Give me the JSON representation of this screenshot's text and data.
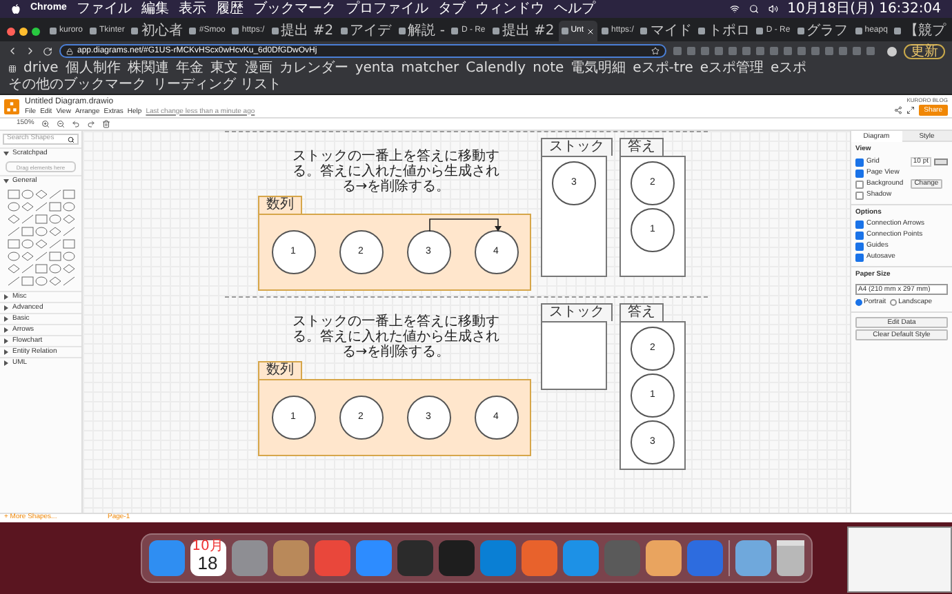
{
  "menubar": {
    "app": "Chrome",
    "items": [
      "ファイル",
      "編集",
      "表示",
      "履歴",
      "ブックマーク",
      "プロファイル",
      "タブ",
      "ウィンドウ",
      "ヘルプ"
    ],
    "clock": "10月18日(月) 16:32:04"
  },
  "tabs": [
    {
      "title": "kuroro",
      "selected": false
    },
    {
      "title": "Tkinter",
      "selected": false
    },
    {
      "title": "初心者",
      "selected": false
    },
    {
      "title": "#Smoo",
      "selected": false
    },
    {
      "title": "https:/",
      "selected": false
    },
    {
      "title": "提出 #2",
      "selected": false
    },
    {
      "title": "アイデ",
      "selected": false
    },
    {
      "title": "解説 -",
      "selected": false
    },
    {
      "title": "D - Re",
      "selected": false
    },
    {
      "title": "提出 #2",
      "selected": false
    },
    {
      "title": "Unt",
      "selected": true
    },
    {
      "title": "https:/",
      "selected": false
    },
    {
      "title": "マイド",
      "selected": false
    },
    {
      "title": "トポロ",
      "selected": false
    },
    {
      "title": "D - Re",
      "selected": false
    },
    {
      "title": "グラフ",
      "selected": false
    },
    {
      "title": "heapq",
      "selected": false
    },
    {
      "title": "【競プ",
      "selected": false
    }
  ],
  "address": {
    "url": "app.diagrams.net/#G1US-rMCKvHScx0wHcvKu_6d0DfGDwOvHj",
    "update_button": "更新"
  },
  "bookmarks": [
    "drive",
    "個人制作",
    "株関連",
    "年金",
    "東文",
    "漫画",
    "カレンダー",
    "yenta",
    "matcher",
    "Calendly",
    "note",
    "電気明細",
    "eスポ-tre",
    "eスポ管理",
    "eスポ",
    "その他のブックマーク",
    "リーディング リスト"
  ],
  "app": {
    "title": "Untitled Diagram.drawio",
    "menu": [
      "File",
      "Edit",
      "View",
      "Arrange",
      "Extras",
      "Help"
    ],
    "last_change": "Last change less than a minute ago",
    "account": "KURORO BLOG",
    "share": "Share",
    "zoom": "150%"
  },
  "sidebar": {
    "search_placeholder": "Search Shapes",
    "scratchpad": {
      "title": "Scratchpad",
      "hint": "Drag elements here",
      "expanded": true
    },
    "general": {
      "title": "General",
      "expanded": true
    },
    "sections": [
      {
        "title": "Misc",
        "expanded": false
      },
      {
        "title": "Advanced",
        "expanded": false
      },
      {
        "title": "Basic",
        "expanded": false
      },
      {
        "title": "Arrows",
        "expanded": false
      },
      {
        "title": "Flowchart",
        "expanded": false
      },
      {
        "title": "Entity Relation",
        "expanded": false
      },
      {
        "title": "UML",
        "expanded": false
      }
    ],
    "more_shapes": "+ More Shapes..."
  },
  "diagrams": [
    {
      "caption": "ストックの一番上を答えに移動する。答えに入れた値から生成される→を削除する。",
      "sequence": {
        "label": "数列",
        "items": [
          "1",
          "2",
          "3",
          "4"
        ],
        "arrow": true
      },
      "stack": {
        "label": "ストック",
        "items": [
          "3"
        ]
      },
      "answer": {
        "label": "答え",
        "items": [
          "2",
          "1"
        ]
      }
    },
    {
      "caption": "ストックの一番上を答えに移動する。答えに入れた値から生成される→を削除する。",
      "sequence": {
        "label": "数列",
        "items": [
          "1",
          "2",
          "3",
          "4"
        ],
        "arrow": false
      },
      "stack": {
        "label": "ストック"
      },
      "answer": {
        "label": "答え",
        "items": [
          "2",
          "1",
          "3"
        ]
      }
    }
  ],
  "page_tab": "Page-1",
  "format_panel": {
    "tabs": [
      {
        "label": "Diagram",
        "selected": true
      },
      {
        "label": "Style",
        "selected": false
      }
    ],
    "view_title": "View",
    "view_options": [
      {
        "label": "Grid",
        "checked": true
      },
      {
        "label": "Page View",
        "checked": true
      },
      {
        "label": "Background",
        "checked": false
      },
      {
        "label": "Shadow",
        "checked": false
      }
    ],
    "grid_size": "10 pt",
    "change_button": "Change",
    "options_title": "Options",
    "options": [
      {
        "label": "Connection Arrows",
        "checked": true
      },
      {
        "label": "Connection Points",
        "checked": true
      },
      {
        "label": "Guides",
        "checked": true
      },
      {
        "label": "Autosave",
        "checked": true
      }
    ],
    "paper_title": "Paper Size",
    "paper": "A4 (210 mm x 297 mm)",
    "orientation": [
      {
        "label": "Portrait",
        "selected": true
      },
      {
        "label": "Landscape",
        "selected": false
      }
    ],
    "buttons": [
      "Edit Data",
      "Clear Default Style"
    ]
  },
  "dock": [
    {
      "kind": "app",
      "color": "#2f8ef2"
    },
    {
      "kind": "calendar",
      "month": "10月",
      "day": "18"
    },
    {
      "kind": "app",
      "color": "#8e8e93"
    },
    {
      "kind": "app",
      "color": "#b9895a"
    },
    {
      "kind": "app",
      "color": "#e9473b"
    },
    {
      "kind": "app",
      "color": "#2d8cff"
    },
    {
      "kind": "app",
      "color": "#2b2b2b"
    },
    {
      "kind": "app",
      "color": "#1e1e1e"
    },
    {
      "kind": "app",
      "color": "#0a7fd4"
    },
    {
      "kind": "app",
      "color": "#e8622c"
    },
    {
      "kind": "app",
      "color": "#1d91e6"
    },
    {
      "kind": "app",
      "color": "#5a5a5a"
    },
    {
      "kind": "app",
      "color": "#e9a45f"
    },
    {
      "kind": "app",
      "color": "#2d6cdf"
    },
    {
      "kind": "divider"
    },
    {
      "kind": "app",
      "color": "#6fa8dc"
    },
    {
      "kind": "trash",
      "color": "#b8b8b8"
    }
  ]
}
